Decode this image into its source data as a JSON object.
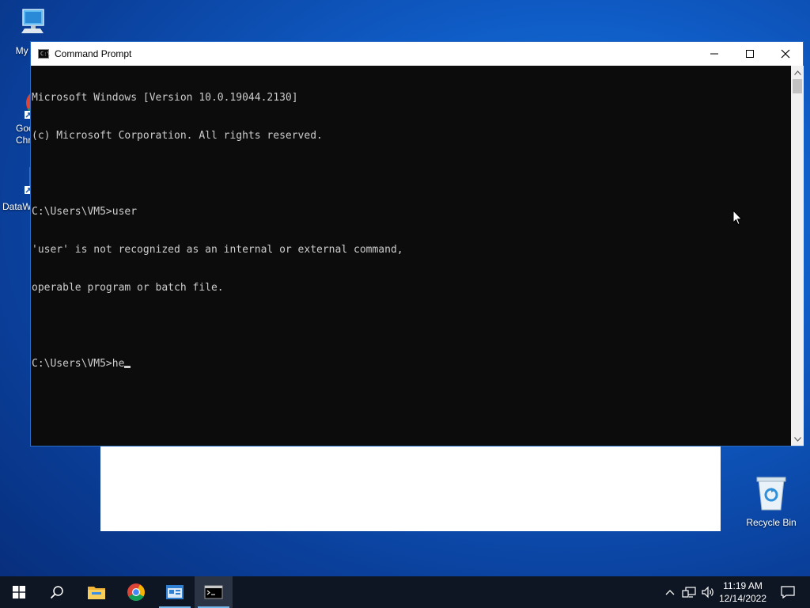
{
  "desktop": {
    "icons": [
      {
        "label": "My Co"
      },
      {
        "label": "Goo\nChro"
      },
      {
        "label": "DataW"
      },
      {
        "label": "Recycle Bin"
      }
    ]
  },
  "window": {
    "title": "Command Prompt",
    "accent_color": "#2b6cc4"
  },
  "console": {
    "lines": [
      "Microsoft Windows [Version 10.0.19044.2130]",
      "(c) Microsoft Corporation. All rights reserved.",
      "",
      "C:\\Users\\VM5>user",
      "'user' is not recognized as an internal or external command,",
      "operable program or batch file.",
      "",
      "C:\\Users\\VM5>he"
    ]
  },
  "taskbar": {
    "items": [
      "start-icon",
      "search-icon",
      "file-explorer-icon",
      "chrome-icon",
      "app-icon",
      "command-prompt-icon"
    ],
    "clock_time": "11:19 AM",
    "clock_date": "12/14/2022"
  },
  "colors": {
    "console_bg": "#0c0c0c",
    "console_fg": "#cccccc",
    "taskbar_bg": "#0f1623"
  }
}
